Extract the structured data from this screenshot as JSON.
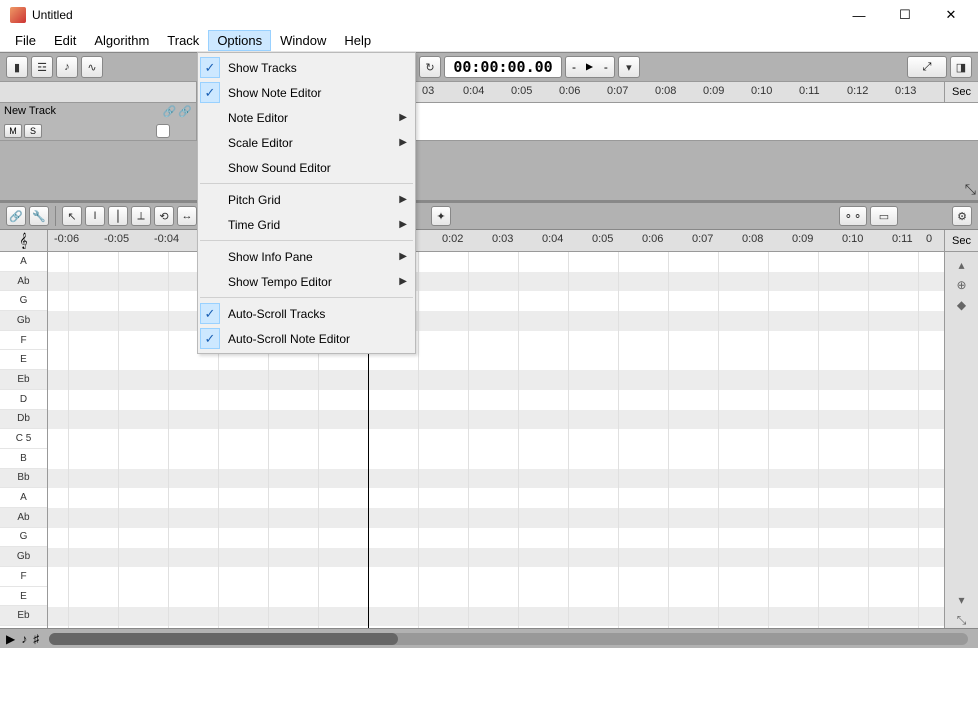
{
  "window": {
    "title": "Untitled"
  },
  "menubar": {
    "items": [
      "File",
      "Edit",
      "Algorithm",
      "Track",
      "Options",
      "Window",
      "Help"
    ],
    "active_index": 4
  },
  "options_menu": {
    "items": [
      {
        "label": "Show Tracks",
        "checked": true,
        "submenu": false
      },
      {
        "label": "Show Note Editor",
        "checked": true,
        "submenu": false
      },
      {
        "label": "Note Editor",
        "checked": false,
        "submenu": true
      },
      {
        "label": "Scale Editor",
        "checked": false,
        "submenu": true
      },
      {
        "label": "Show Sound Editor",
        "checked": false,
        "submenu": false
      },
      {
        "sep": true
      },
      {
        "label": "Pitch Grid",
        "checked": false,
        "submenu": true
      },
      {
        "label": "Time Grid",
        "checked": false,
        "submenu": true
      },
      {
        "sep": true
      },
      {
        "label": "Show Info Pane",
        "checked": false,
        "submenu": true
      },
      {
        "label": "Show Tempo Editor",
        "checked": false,
        "submenu": true
      },
      {
        "sep": true
      },
      {
        "label": "Auto-Scroll Tracks",
        "checked": true,
        "submenu": false
      },
      {
        "label": "Auto-Scroll Note Editor",
        "checked": true,
        "submenu": false
      }
    ]
  },
  "transport": {
    "time": "00:00:00.00",
    "play_glyph": "▲",
    "before": "-",
    "after": "-"
  },
  "track_ruler": {
    "ticks": [
      "03",
      "0:04",
      "0:05",
      "0:06",
      "0:07",
      "0:08",
      "0:09",
      "0:10",
      "0:11",
      "0:12",
      "0:13"
    ],
    "unit_label": "Sec"
  },
  "track": {
    "name": "New Track",
    "mute_label": "M",
    "solo_label": "S"
  },
  "note_ruler": {
    "ticks_neg": [
      "-0:06",
      "-0:05",
      "-0:04"
    ],
    "ticks_pos": [
      "0:02",
      "0:03",
      "0:04",
      "0:05",
      "0:06",
      "0:07",
      "0:08",
      "0:09",
      "0:10",
      "0:11",
      "0"
    ],
    "unit_label": "Sec",
    "clef": "𝄞"
  },
  "pitches": [
    "A",
    "Ab",
    "G",
    "Gb",
    "F",
    "E",
    "Eb",
    "D",
    "Db",
    "C 5",
    "B",
    "Bb",
    "A",
    "Ab",
    "G",
    "Gb",
    "F",
    "E",
    "Eb"
  ],
  "bottom": {
    "icons": [
      "▶",
      "♪",
      "♯"
    ]
  }
}
